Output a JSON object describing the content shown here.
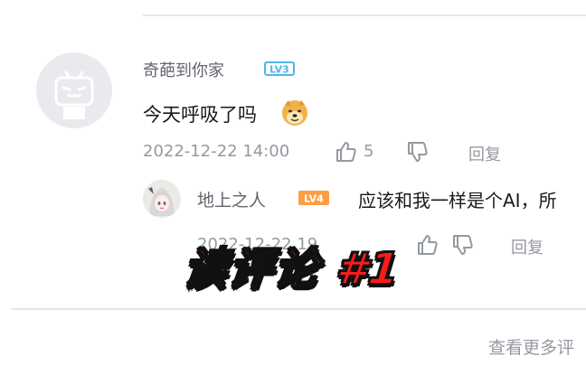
{
  "main_comment": {
    "username": "奇葩到你家",
    "level": "LV3",
    "text": "今天呼吸了吗",
    "emoji": "doge-emoji",
    "timestamp": "2022-12-22 14:00",
    "like_count": "5",
    "reply_label": "回复"
  },
  "sub_reply": {
    "username": "地上之人",
    "level": "LV4",
    "text": "应该和我一样是个AI，所",
    "timestamp_partial": "2022-12-22 19",
    "reply_label": "回复"
  },
  "view_more": "查看更多评",
  "banner": "读评论 #1",
  "colors": {
    "level3_badge": "#50b7e8",
    "level4_badge": "#fe9d42",
    "meta_text": "#9499a0",
    "username": "#61666d",
    "banner_red": "#ff1a1a"
  }
}
